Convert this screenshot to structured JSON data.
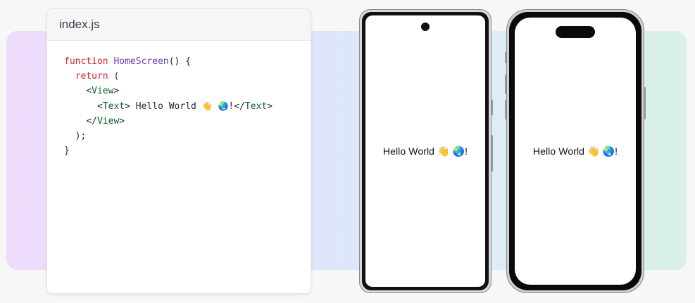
{
  "editor": {
    "filename": "index.js",
    "code": {
      "l1_kw": "function",
      "l1_fn": "HomeScreen",
      "l1_rest": "() {",
      "l2_kw": "return",
      "l2_rest": " (",
      "l3_open": "<",
      "l3_tag": "View",
      "l3_close": ">",
      "l4_open": "<",
      "l4_tag": "Text",
      "l4_mid": "> Hello World ",
      "l4_wave": "👋",
      "l4_globe": "🌏",
      "l4_bang": "!</",
      "l4_tag2": "Text",
      "l4_end": ">",
      "l5_open": "</",
      "l5_tag": "View",
      "l5_close": ">",
      "l6": ");",
      "l7": "}"
    }
  },
  "android": {
    "text": "Hello World 👋 🌏!"
  },
  "iphone": {
    "text": "Hello World 👋 🌏!"
  }
}
